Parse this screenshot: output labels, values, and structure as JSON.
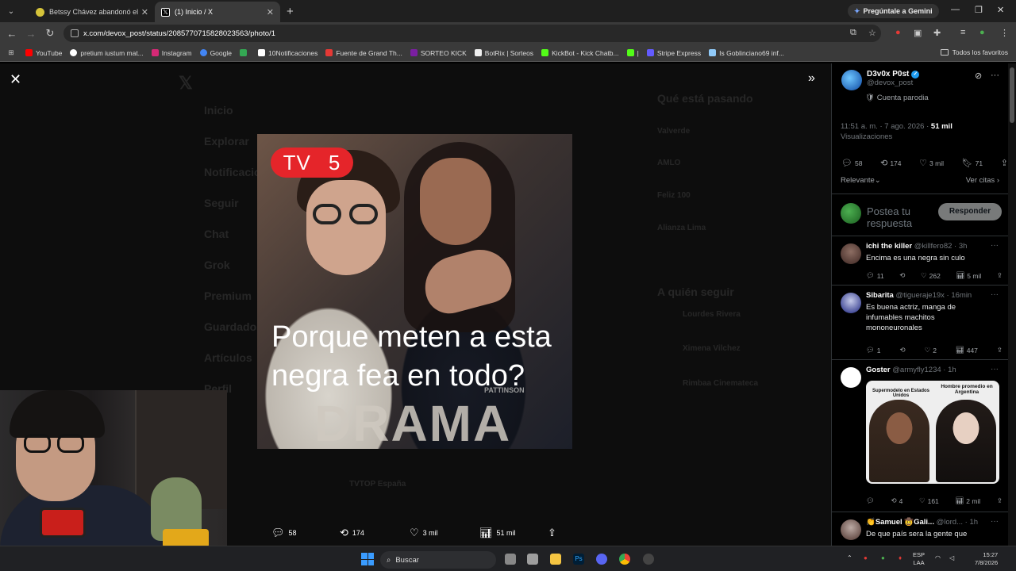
{
  "browser": {
    "tabs": [
      {
        "title": "Betssy Chávez abandonó el Pe",
        "favicon_color": "#d6c43a"
      },
      {
        "title": "(1) Inicio / X",
        "favicon_color": "#ffffff"
      }
    ],
    "gemini_label": "Pregúntale a Gemini",
    "url": "x.com/devox_post/status/2085770715828023563/photo/1",
    "bookmarks": [
      {
        "label": "YouTube",
        "color": "#ff0000"
      },
      {
        "label": "pretium iustum mat...",
        "color": "#ffffff"
      },
      {
        "label": "Instagram",
        "color": "#d62976"
      },
      {
        "label": "Google",
        "color": "#4285f4"
      },
      {
        "label": "",
        "color": "#34a853"
      },
      {
        "label": "10Notificaciones",
        "color": "#ffffff"
      },
      {
        "label": "Fuente de Grand Th...",
        "color": "#e53935"
      },
      {
        "label": "SORTEO KICK",
        "color": "#7b1fa2"
      },
      {
        "label": "BotRix | Sorteos",
        "color": "#eeeeee"
      },
      {
        "label": "KickBot - Kick Chatb...",
        "color": "#53fc18"
      },
      {
        "label": "|",
        "color": "#53fc18"
      },
      {
        "label": "Stripe Express",
        "color": "#635bff"
      },
      {
        "label": "Is Goblinciano69 inf...",
        "color": "#90caf9"
      }
    ],
    "bookmarks_right": "Todos los favoritos"
  },
  "viewer": {
    "photo": {
      "badge_left": "TV",
      "badge_right": "5",
      "caption": "Porque meten a esta negra fea en todo?",
      "drama_text": "DRAMA",
      "pattinson_text": "PATTINSON"
    },
    "actions": {
      "replies": "58",
      "reposts": "174",
      "likes": "3 mil",
      "views": "51 mil"
    },
    "ghost": {
      "nav": [
        "Inicio",
        "Explorar",
        "Notificaciones",
        "Seguir",
        "Chat",
        "Grok",
        "Premium",
        "Guardados",
        "Artículos",
        "Perfil"
      ],
      "trending_title": "Qué está pasando",
      "trends": [
        "Valverde",
        "AMLO",
        "Feliz 100",
        "Alianza Lima"
      ],
      "follow_title": "A quién seguir",
      "follow": [
        "Lourdes Rivera",
        "Ximena Vilchez",
        "Rimbaa Cinemateca"
      ],
      "ghost_post_user": "TVTOP España"
    }
  },
  "sidebar": {
    "author_name": "D3v0x P0st",
    "author_handle": "@devox_post",
    "parody_label": "Cuenta parodia",
    "time": "11:51 a. m. · 7 ago. 2026 · ",
    "views_value": "51 mil",
    "views_label": "Visualizaciones",
    "stats": {
      "replies": "58",
      "reposts": "174",
      "likes": "3 mil",
      "bookmarks": "71"
    },
    "sort_label": "Relevante",
    "quotes_label": "Ver citas",
    "reply_placeholder": "Postea tu respuesta",
    "reply_button": "Responder",
    "replies": [
      {
        "name": "ichi the killer",
        "handle": "@killfero82 · 3h",
        "text": "Encima es una negra sin culo",
        "stats": [
          "11",
          "",
          "262",
          "5 mil"
        ]
      },
      {
        "name": "Sibarita",
        "handle": "@tigueraje19x · 16min",
        "text": "Es buena actriz, manga de infumables machitos mononeuronales",
        "stats": [
          "1",
          "",
          "2",
          "447"
        ]
      },
      {
        "name": "Goster",
        "handle": "@armyfly1234 · 1h",
        "text": "",
        "stats": [
          "",
          "4",
          "161",
          "2 mil"
        ],
        "image_labels": [
          "Supermodelo en Estados Unidos",
          "Hombre promedio en Argentina"
        ]
      },
      {
        "name": "👏Samuel 🤠Gali...",
        "handle": "@lord... · 1h",
        "text": "De que país sera la gente que"
      }
    ]
  },
  "taskbar": {
    "search": "Buscar",
    "lang_top": "ESP",
    "lang_bottom": "LAA",
    "time": "15:27",
    "date": "7/8/2026"
  }
}
